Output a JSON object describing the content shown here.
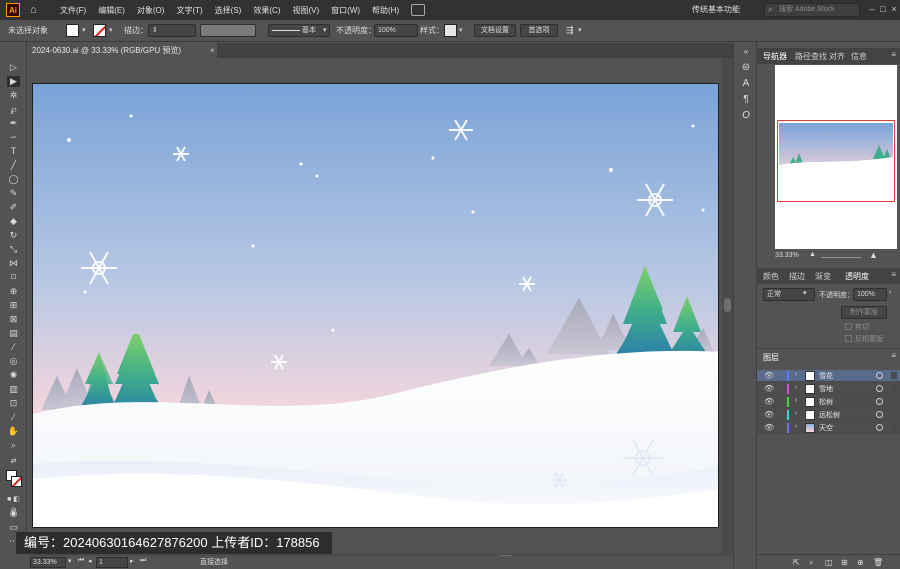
{
  "menubar": {
    "logo": "Ai",
    "items": [
      "文件(F)",
      "编辑(E)",
      "对象(O)",
      "文字(T)",
      "选择(S)",
      "效果(C)",
      "视图(V)",
      "窗口(W)",
      "帮助(H)"
    ],
    "workspace": "传统基本功能",
    "search_placeholder": "搜索 Adobe Stock"
  },
  "controlbar": {
    "selection": "未选择对象",
    "stroke_label": "描边：",
    "stroke_style": "基本",
    "opacity_label": "不透明度：",
    "opacity_value": "100%",
    "style_label": "样式：",
    "doc_setup": "文档设置",
    "preferences": "首选项"
  },
  "document": {
    "tab_title": "2024-0630.ai @ 33.33% (RGB/GPU 预览)",
    "close": "×"
  },
  "statusbar": {
    "zoom": "33.33%",
    "artboard": "1",
    "tool": "直接选择"
  },
  "watermark": {
    "id_text": "编号：20240630164627876200    上传者ID：178856"
  },
  "navigator_panel": {
    "tabs": [
      "导航器",
      "路径查找",
      "对齐",
      "信息"
    ],
    "zoom": "33.33%"
  },
  "transparency_panel": {
    "tabs": [
      "颜色",
      "描边",
      "渐变",
      "透明度"
    ],
    "blend_mode": "正常",
    "opacity_label": "不透明度：",
    "opacity_value": "100%",
    "make_mask": "制作蒙版",
    "clip": "剪切",
    "invert_mask": "反相蒙版"
  },
  "layers_panel": {
    "title": "图层",
    "layers": [
      {
        "name": "雪花",
        "color": "#4f7cff"
      },
      {
        "name": "雪地",
        "color": "#d64fd6"
      },
      {
        "name": "松树",
        "color": "#3ad63a"
      },
      {
        "name": "远松树",
        "color": "#3ad6d6"
      },
      {
        "name": "天空",
        "color": "#6f6fff"
      }
    ]
  },
  "colors": {
    "sky_top": "#7ea6d9",
    "sky_bottom": "#f7d6dc",
    "snow": "#ffffff",
    "tree_green": "#4fbf6a",
    "tree_teal": "#2f9aa8"
  }
}
